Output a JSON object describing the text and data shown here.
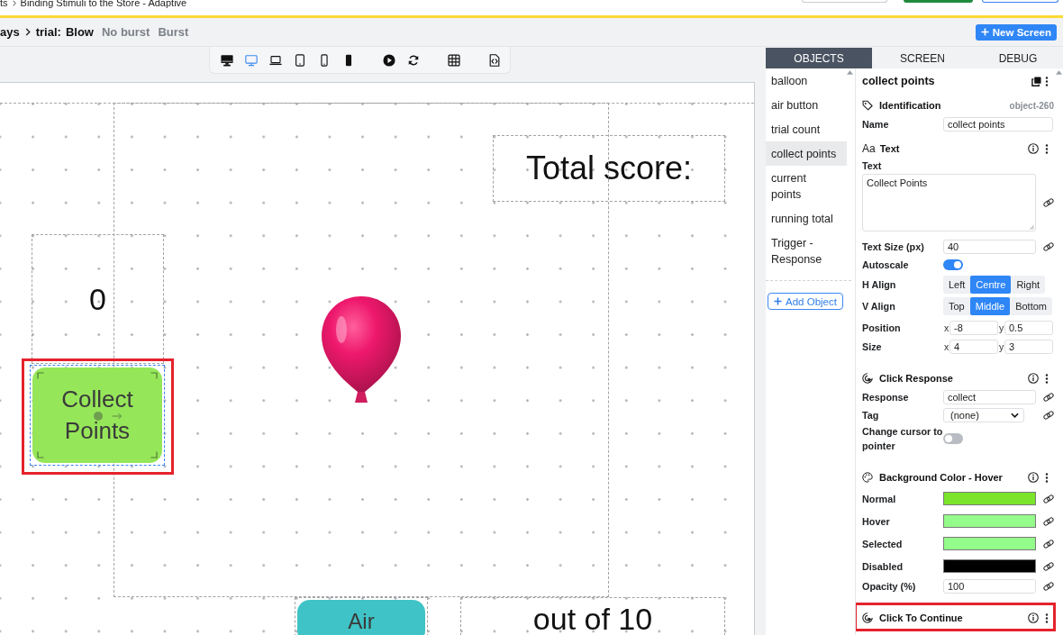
{
  "breadcrumb": [
    "ts",
    "Binding Stimuli to the Store - Adaptive"
  ],
  "screen_bar": {
    "path": [
      "ays"
    ],
    "trial_label": "trial:",
    "screens": [
      {
        "label": "Blow",
        "selected": true
      },
      {
        "label": "No burst",
        "selected": false
      },
      {
        "label": "Burst",
        "selected": false
      }
    ],
    "new_screen_button": "New Screen"
  },
  "device_toolbar": {
    "devices": [
      {
        "kind": "desktop",
        "selected": false
      },
      {
        "kind": "monitor",
        "selected": true
      },
      {
        "kind": "laptop",
        "selected": false
      },
      {
        "kind": "tablet",
        "selected": false
      },
      {
        "kind": "phone",
        "selected": false
      },
      {
        "kind": "phone-dark",
        "selected": false
      }
    ]
  },
  "canvas": {
    "objects": [
      {
        "kind": "text",
        "text": "Total score:",
        "selected": false,
        "highlighted": false
      },
      {
        "kind": "text",
        "text": "0",
        "selected": false,
        "highlighted": false
      },
      {
        "kind": "image",
        "selected": false,
        "highlighted": false
      },
      {
        "kind": "button",
        "text": "Collect Points",
        "color": "#96e65a",
        "selected": true,
        "highlighted": true
      },
      {
        "kind": "button",
        "text": "Air",
        "color": "#3fc3c6",
        "selected": false,
        "highlighted": false
      },
      {
        "kind": "text",
        "text": "out of 10",
        "selected": false,
        "highlighted": false
      }
    ]
  },
  "panel": {
    "tabs": [
      {
        "label": "OBJECTS",
        "selected": true
      },
      {
        "label": "SCREEN",
        "selected": false
      },
      {
        "label": "DEBUG",
        "selected": false
      }
    ],
    "objects_list": {
      "items": [
        {
          "label": "balloon",
          "selected": false
        },
        {
          "label": "air button",
          "selected": false
        },
        {
          "label": "trial count",
          "selected": false
        },
        {
          "label": "collect points",
          "selected": true
        },
        {
          "label": "current points",
          "selected": false
        },
        {
          "label": "running total",
          "selected": false
        },
        {
          "label": "Trigger - Response",
          "selected": false
        }
      ],
      "add_button": "Add Object"
    },
    "properties": {
      "title": "collect points",
      "sections": [
        {
          "kind": "identification",
          "title": "Identification",
          "badge": "object-260",
          "info": false,
          "menu": false,
          "highlighted": false,
          "rows": [
            {
              "kind": "input",
              "label": "Name",
              "value": "collect points",
              "link": false
            }
          ]
        },
        {
          "kind": "text",
          "glyph": "Aa",
          "title": "Text",
          "info": true,
          "menu": true,
          "highlighted": false,
          "rows": [
            {
              "kind": "textarea",
              "label": "Text",
              "value": "Collect Points",
              "link": true
            },
            {
              "kind": "input",
              "label": "Text Size (px)",
              "value": "40",
              "link": true
            },
            {
              "kind": "toggle",
              "label": "Autoscale",
              "on": true
            },
            {
              "kind": "segmented",
              "label": "H Align",
              "options": [
                {
                  "label": "Left",
                  "selected": false
                },
                {
                  "label": "Centre",
                  "selected": true
                },
                {
                  "label": "Right",
                  "selected": false
                }
              ]
            },
            {
              "kind": "segmented",
              "label": "V Align",
              "options": [
                {
                  "label": "Top",
                  "selected": false
                },
                {
                  "label": "Middle",
                  "selected": true
                },
                {
                  "label": "Bottom",
                  "selected": false
                }
              ]
            },
            {
              "kind": "xy",
              "label": "Position",
              "fields": [
                {
                  "axis": "x",
                  "value": "-8"
                },
                {
                  "axis": "y",
                  "value": "0.5"
                }
              ]
            },
            {
              "kind": "xy",
              "label": "Size",
              "fields": [
                {
                  "axis": "x",
                  "value": "4"
                },
                {
                  "axis": "y",
                  "value": "3"
                }
              ]
            }
          ]
        },
        {
          "kind": "click-response",
          "title": "Click Response",
          "info": true,
          "menu": true,
          "highlighted": false,
          "rows": [
            {
              "kind": "input",
              "label": "Response",
              "value": "collect",
              "link": true
            },
            {
              "kind": "select",
              "label": "Tag",
              "value": "(none)",
              "link": true
            },
            {
              "kind": "toggle",
              "label": "Change cursor to pointer",
              "on": false
            }
          ]
        },
        {
          "kind": "background-color",
          "title": "Background Color - Hover",
          "info": true,
          "menu": true,
          "highlighted": false,
          "rows": [
            {
              "kind": "color",
              "label": "Normal",
              "color": "#7be42b",
              "link": true
            },
            {
              "kind": "color",
              "label": "Hover",
              "color": "#94fc8a",
              "link": true
            },
            {
              "kind": "color",
              "label": "Selected",
              "color": "#94fc8a",
              "link": true
            },
            {
              "kind": "color",
              "label": "Disabled",
              "color": "#000000",
              "link": true
            },
            {
              "kind": "input",
              "label": "Opacity (%)",
              "value": "100",
              "link": true
            }
          ]
        },
        {
          "kind": "click-to-continue",
          "title": "Click To Continue",
          "info": true,
          "menu": true,
          "highlighted": true
        }
      ]
    }
  }
}
